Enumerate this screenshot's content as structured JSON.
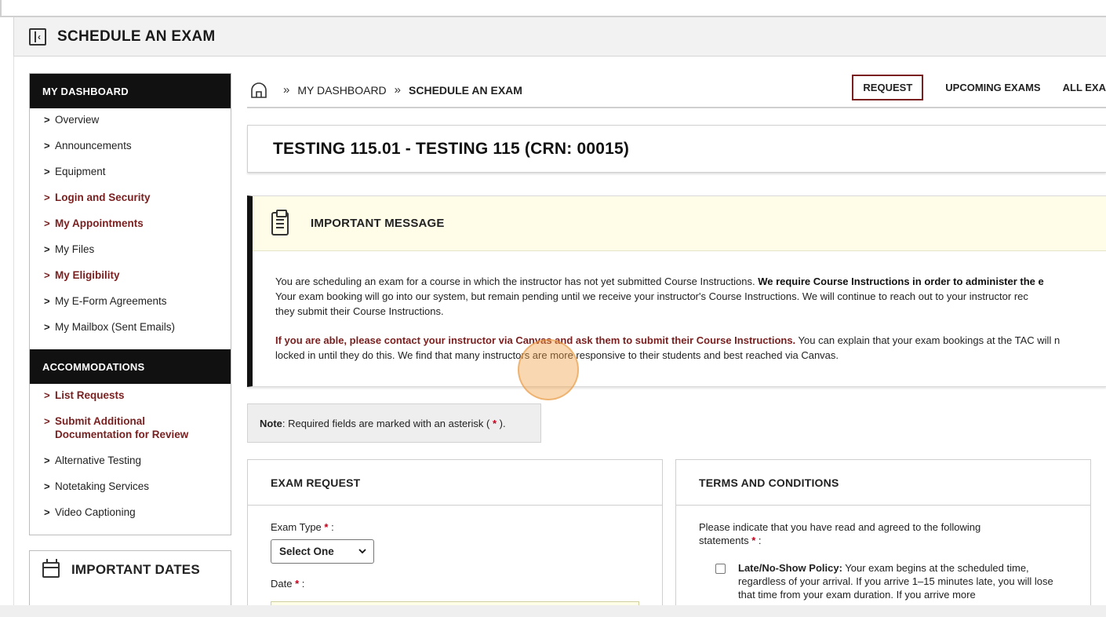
{
  "header": {
    "title": "SCHEDULE AN EXAM"
  },
  "sidebar": {
    "dashboard_heading": "MY DASHBOARD",
    "dashboard_items": [
      {
        "label": "Overview",
        "bold": false
      },
      {
        "label": "Announcements",
        "bold": false
      },
      {
        "label": "Equipment",
        "bold": false
      },
      {
        "label": "Login and Security",
        "bold": true
      },
      {
        "label": "My Appointments",
        "bold": true
      },
      {
        "label": "My Files",
        "bold": false
      },
      {
        "label": "My Eligibility",
        "bold": true
      },
      {
        "label": "My E-Form Agreements",
        "bold": false
      },
      {
        "label": "My Mailbox (Sent Emails)",
        "bold": false
      }
    ],
    "accommodations_heading": "ACCOMMODATIONS",
    "accommodations_items": [
      {
        "label": "List Requests",
        "bold": true
      },
      {
        "label": "Submit Additional Documentation for Review",
        "bold": true
      },
      {
        "label": "Alternative Testing",
        "bold": false
      },
      {
        "label": "Notetaking Services",
        "bold": false
      },
      {
        "label": "Video Captioning",
        "bold": false
      }
    ],
    "important_dates_title": "IMPORTANT DATES",
    "chevron": ">"
  },
  "breadcrumb": {
    "separator": "»",
    "items": [
      "MY DASHBOARD",
      "SCHEDULE AN EXAM"
    ]
  },
  "tabs": [
    {
      "label": "REQUEST",
      "active": true
    },
    {
      "label": "UPCOMING EXAMS",
      "active": false
    },
    {
      "label": "ALL EXA",
      "active": false
    }
  ],
  "course": {
    "title": "TESTING 115.01 - TESTING 115 (CRN: 00015)"
  },
  "message": {
    "title": "IMPORTANT MESSAGE",
    "p1_line1_plain": "You are scheduling an exam for a course in which the instructor has not yet submitted Course Instructions. ",
    "p1_line1_bold": "We require Course Instructions in order to administer the e",
    "p1_line2": "Your exam booking will go into our system, but remain pending until we receive your instructor's Course Instructions. We will continue to reach out to your instructor rec",
    "p1_line3": "they submit their Course Instructions.",
    "p2_line1_bold": "If you are able, please contact your instructor via Canvas and ask them to submit their Course Instructions.",
    "p2_line1_plain": " You can explain that your exam bookings at the TAC will n",
    "p2_line2": "locked in until they do this. We find that many instructors are more responsive to their students and best reached via Canvas."
  },
  "note": {
    "label": "Note",
    "text": ": Required fields are marked with an asterisk (",
    "star": "*",
    "close": ")."
  },
  "exam_request": {
    "title": "EXAM REQUEST",
    "exam_type_label": "Exam Type",
    "star": "*",
    "colon": ":",
    "exam_type_value": "Select One",
    "date_label": "Date"
  },
  "terms": {
    "title": "TERMS AND CONDITIONS",
    "intro": "Please indicate that you have read and agreed to the following statements",
    "star": "*",
    "colon": ":",
    "policy_title": "Late/No-Show Policy:",
    "policy_text": " Your exam begins at the scheduled time, regardless of your arrival. If you arrive 1–15 minutes late, you will lose that time from your exam duration. If you arrive more"
  }
}
